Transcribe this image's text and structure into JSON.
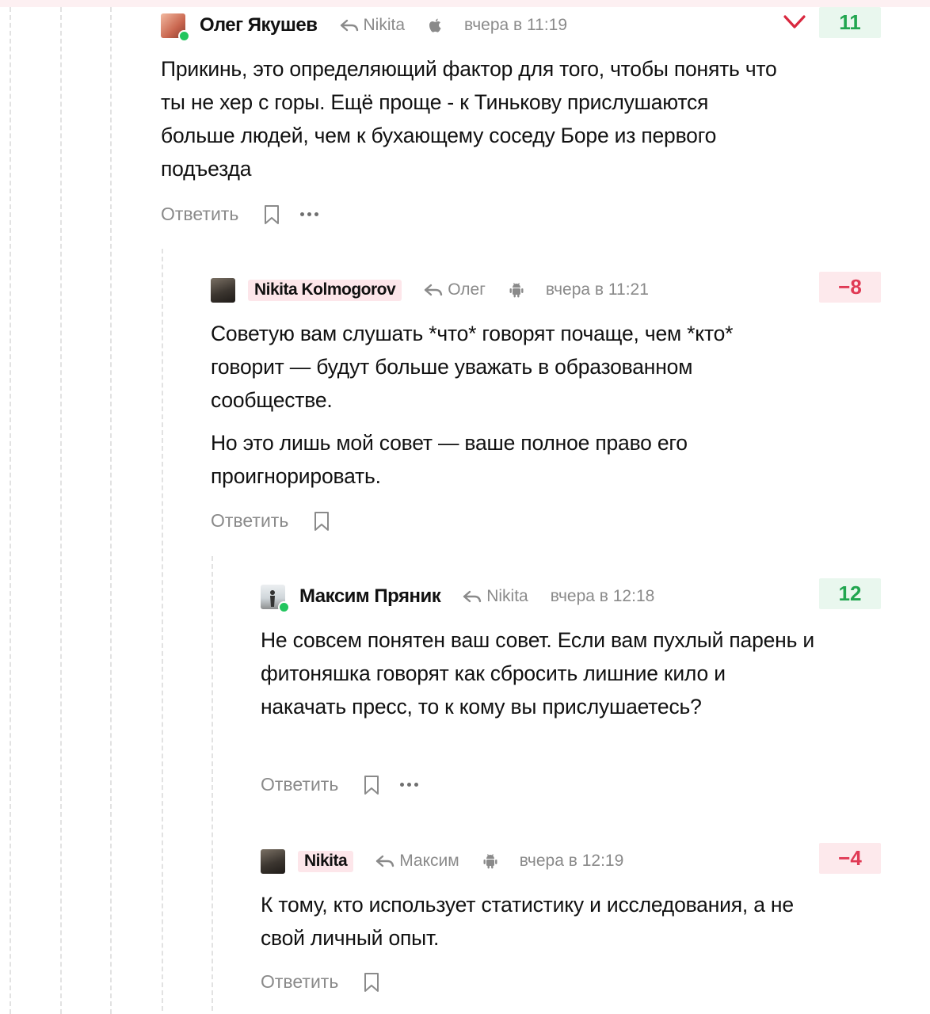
{
  "comments": [
    {
      "author": "Олег Якушев",
      "reply_to": "Nikita",
      "platform_icon": "apple-icon",
      "time": "вчера в 11:19",
      "paragraphs": [
        "Прикинь, это определяющий фактор для того, чтобы понять что ты не хер с горы. Ещё проще - к Тинькову прислушаются больше людей, чем к бухающему соседу Боре из первого подъезда"
      ],
      "reply_label": "Ответить",
      "score": "11",
      "online": true
    },
    {
      "author": "Nikita Kolmogorov",
      "reply_to": "Олег",
      "platform_icon": "android-icon",
      "time": "вчера в 11:21",
      "paragraphs": [
        "Советую вам слушать *что* говорят почаще, чем *кто* говорит — будут больше уважать в образованном сообществе.",
        "Но это лишь мой совет — ваше полное право его проигнорировать."
      ],
      "reply_label": "Ответить",
      "score": "−8"
    },
    {
      "author": "Максим Пряник",
      "reply_to": "Nikita",
      "time": "вчера в 12:18",
      "paragraphs": [
        "Не совсем понятен ваш совет. Если вам пухлый парень и фитоняшка говорят как сбросить лишние кило и накачать пресс, то к кому вы прислушаетесь?"
      ],
      "reply_label": "Ответить",
      "score": "12",
      "online": true
    },
    {
      "author": "Nikita",
      "reply_to": "Максим",
      "platform_icon": "android-icon",
      "time": "вчера в 12:19",
      "paragraphs": [
        "К тому, кто использует статистику и исследования, а не свой личный опыт."
      ],
      "reply_label": "Ответить",
      "score": "−4"
    }
  ],
  "colors": {
    "positive": "#22a650",
    "negative": "#e03a55",
    "op_highlight": "#fde6ea",
    "vote_down": "#d9283f"
  },
  "icons": {
    "bookmark": "bookmark-icon",
    "more": "more-icon",
    "reply": "reply-arrow-icon",
    "vote_down": "chevron-down-icon"
  }
}
